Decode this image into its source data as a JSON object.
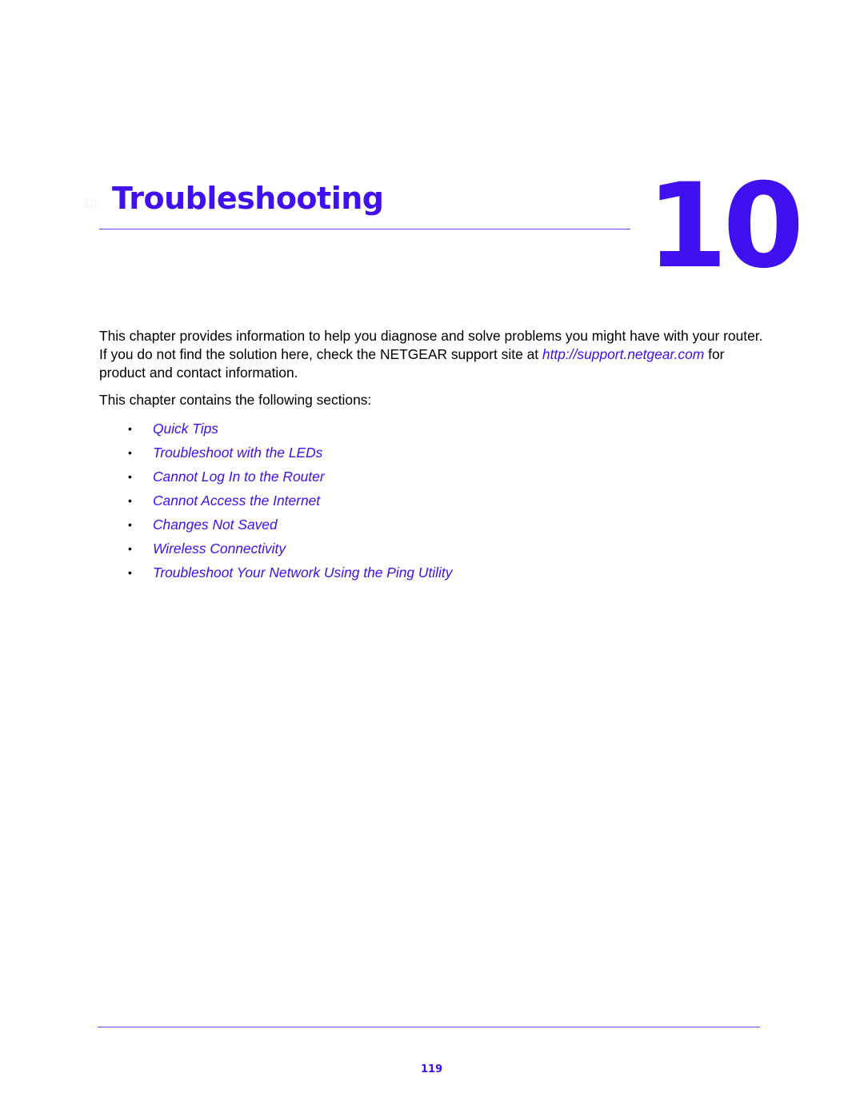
{
  "chapter": {
    "faint_label": "10.",
    "title": "Troubleshooting",
    "number": "10"
  },
  "intro": {
    "text_before_link": "This chapter provides information to help you diagnose and solve problems you might have with your router. If you do not find the solution here, check the NETGEAR support site at ",
    "link_text": "http://support.netgear.com",
    "text_after_link": " for product and contact information."
  },
  "sections": {
    "intro": "This chapter contains the following sections:",
    "bullet_glyph": "•",
    "items": [
      {
        "label": "Quick Tips"
      },
      {
        "label": "Troubleshoot with the LEDs"
      },
      {
        "label": "Cannot Log In to the Router"
      },
      {
        "label": "Cannot Access the Internet"
      },
      {
        "label": "Changes Not Saved"
      },
      {
        "label": "Wireless Connectivity"
      },
      {
        "label": "Troubleshoot Your Network Using the Ping Utility"
      }
    ]
  },
  "footer": {
    "page_number": "119"
  },
  "colors": {
    "accent": "#4010f0",
    "rule": "#6a3cf5",
    "body_text": "#000000"
  }
}
